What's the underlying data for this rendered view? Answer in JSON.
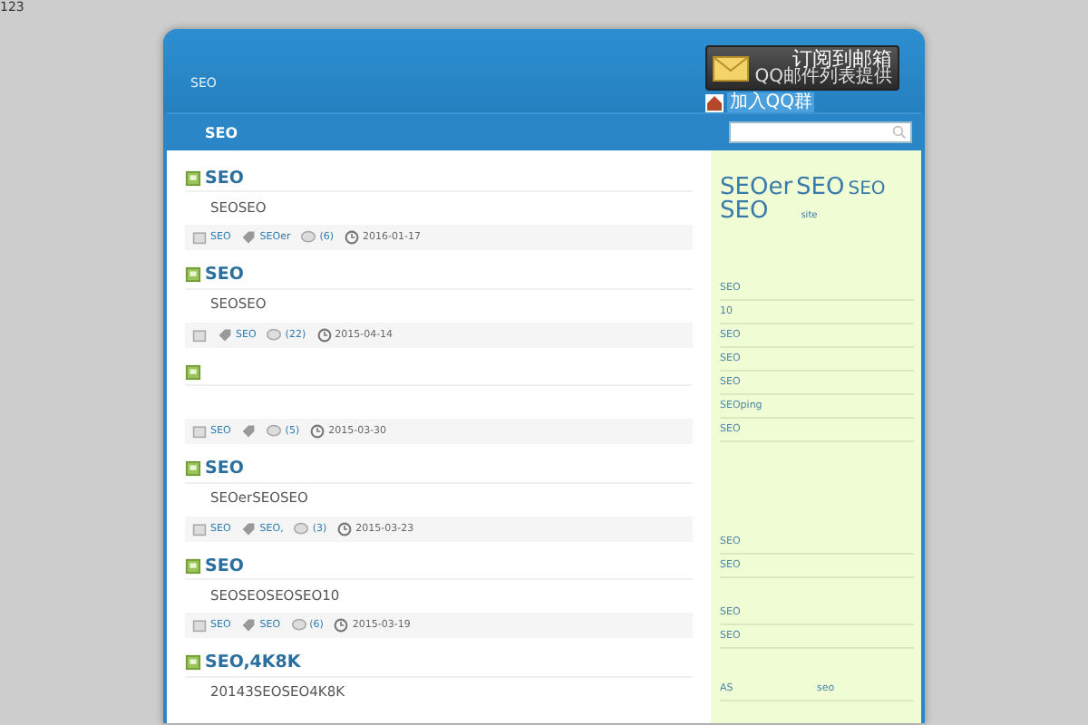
{
  "page_corner": "123",
  "header": {
    "tagline": "SEO",
    "subscribe": {
      "title": "订阅到邮箱",
      "subtitle": "QQ邮件列表提供"
    },
    "qq_group": "加入QQ群"
  },
  "nav": {
    "title": "SEO"
  },
  "posts": [
    {
      "title": "SEO",
      "excerpt": "SEOSEO",
      "category": "SEO",
      "tags": "SEOer",
      "comments": "(6)",
      "date": "2016-01-17"
    },
    {
      "title": "SEO",
      "excerpt": "SEOSEO",
      "tags": "SEO",
      "comments": "(22)",
      "date": "2015-04-14"
    },
    {
      "category": "SEO",
      "comments": "(5)",
      "date": "2015-03-30"
    },
    {
      "title": "SEO",
      "excerpt": "SEOerSEOSEO",
      "category": "SEO",
      "tags": "SEO,",
      "comments": "(3)",
      "date": "2015-03-23"
    },
    {
      "title": "SEO",
      "excerpt": "SEOSEOSEOSEO10",
      "category": "SEO",
      "tags": "SEO",
      "comments": "(6)",
      "date": "2015-03-19"
    },
    {
      "title": "SEO,4K8K",
      "excerpt": "20143SEOSEO4K8K"
    }
  ],
  "sidebar": {
    "tag_cloud": [
      {
        "text": "SEOer",
        "kind": "large"
      },
      {
        "text": "SEO",
        "kind": "large"
      },
      {
        "text": "SEO",
        "kind": "medium"
      },
      {
        "text": "SEO",
        "kind": "large"
      },
      {
        "text": "site",
        "kind": "small"
      }
    ],
    "groups": [
      {
        "kind": "list",
        "items": [
          "SEO",
          "10",
          "SEO",
          "SEO",
          "SEO",
          "SEOping",
          "SEO"
        ]
      },
      {
        "kind": "list",
        "items": [
          "SEO",
          "SEO"
        ]
      },
      {
        "kind": "list",
        "items": [
          "SEO",
          "SEO"
        ]
      },
      {
        "kind": "pairs",
        "items": [
          "AS",
          "seo"
        ]
      }
    ]
  }
}
